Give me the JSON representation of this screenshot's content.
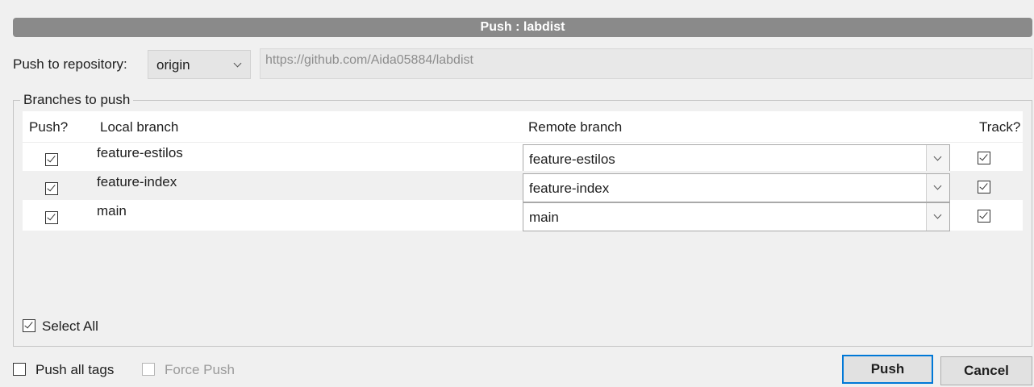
{
  "dialog": {
    "title": "Push : labdist"
  },
  "repository": {
    "label": "Push to repository:",
    "selected": "origin",
    "url": "https://github.com/Aida05884/labdist"
  },
  "branches": {
    "group_label": "Branches to push",
    "columns": {
      "push": "Push?",
      "local": "Local branch",
      "remote": "Remote branch",
      "track": "Track?"
    },
    "rows": [
      {
        "push": true,
        "local": "feature-estilos",
        "remote": "feature-estilos",
        "track": true
      },
      {
        "push": true,
        "local": "feature-index",
        "remote": "feature-index",
        "track": true
      },
      {
        "push": true,
        "local": "main",
        "remote": "main",
        "track": true
      }
    ],
    "select_all": {
      "label": "Select All",
      "checked": true
    }
  },
  "options": {
    "push_all_tags": {
      "label": "Push all tags",
      "checked": false
    },
    "force_push": {
      "label": "Force Push",
      "checked": false,
      "enabled": false
    }
  },
  "buttons": {
    "push": "Push",
    "cancel": "Cancel"
  }
}
